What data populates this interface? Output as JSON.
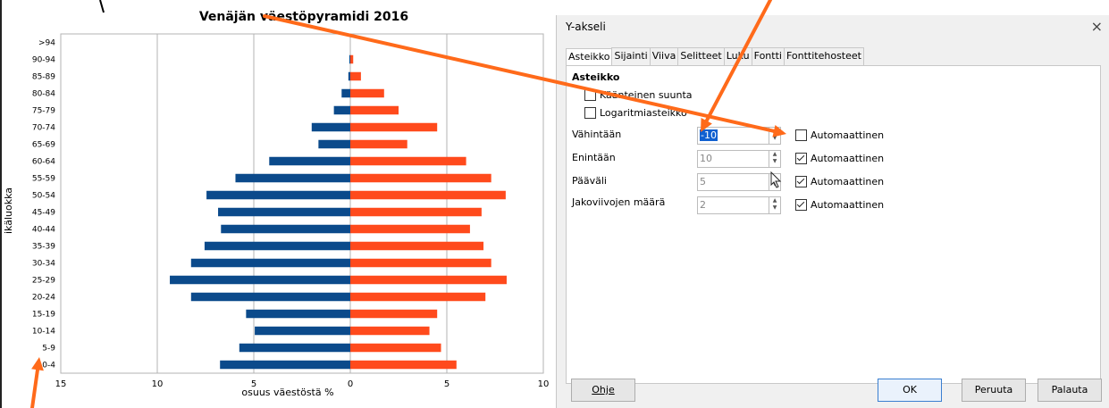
{
  "chart_data": {
    "type": "bar",
    "orientation": "horizontal",
    "title": "Venäjän väestöpyramidi 2016",
    "xlabel": "osuus väestöstä %",
    "ylabel": "ikäluokka",
    "xlim": [
      -15,
      10
    ],
    "x_ticks": [
      "15",
      "10",
      "5",
      "0",
      "5",
      "10"
    ],
    "categories": [
      ">94",
      "90-94",
      "85-89",
      "80-84",
      "75-79",
      "70-74",
      "65-69",
      "60-64",
      "55-59",
      "50-54",
      "45-49",
      "40-44",
      "35-39",
      "30-34",
      "25-29",
      "20-24",
      "15-19",
      "10-14",
      "5-9",
      "0-4"
    ],
    "series": [
      {
        "name": "",
        "color": "#0b4a8b",
        "values": [
          0,
          0.05,
          0.1,
          0.45,
          0.85,
          2.0,
          1.65,
          4.2,
          5.95,
          7.45,
          6.85,
          6.7,
          7.55,
          8.25,
          9.35,
          8.25,
          5.4,
          4.95,
          5.75,
          6.75
        ]
      },
      {
        "name": "",
        "color": "#ff4a1c",
        "values": [
          0,
          0.15,
          0.55,
          1.75,
          2.5,
          4.5,
          2.95,
          6.0,
          7.3,
          8.05,
          6.8,
          6.2,
          6.9,
          7.3,
          8.1,
          7.0,
          4.5,
          4.1,
          4.7,
          5.5
        ]
      }
    ]
  },
  "dialog": {
    "title": "Y-akseli",
    "close": "×",
    "tabs": [
      "Asteikko",
      "Sijainti",
      "Viiva",
      "Selitteet",
      "Luku",
      "Fontti",
      "Fonttitehosteet"
    ],
    "section": "Asteikko",
    "reverse": {
      "label": "Käänteinen suunta",
      "checked": false
    },
    "log": {
      "label": "Logaritmiasteikko",
      "checked": false
    },
    "rows": [
      {
        "label": "Vähintään",
        "value": "-10",
        "auto_label": "Automaattinen",
        "auto": false
      },
      {
        "label": "Enintään",
        "value": "10",
        "auto_label": "Automaattinen",
        "auto": true
      },
      {
        "label": "Pääväli",
        "value": "5",
        "auto_label": "Automaattinen",
        "auto": true
      },
      {
        "label": "Jakoviivojen määrä",
        "value": "2",
        "auto_label": "Automaattinen",
        "auto": true
      }
    ],
    "buttons": {
      "help": "Ohje",
      "ok": "OK",
      "cancel": "Peruuta",
      "reset": "Palauta"
    }
  },
  "annotation_color": "#ff6a1a"
}
